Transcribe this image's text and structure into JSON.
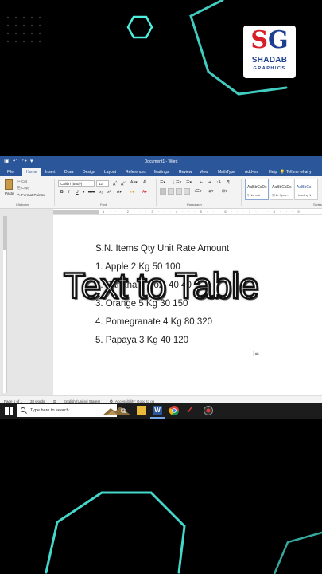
{
  "brand": {
    "logo_initials": "SG",
    "name": "SHADAB",
    "tagline": "GRAPHICS"
  },
  "overlay": {
    "title": "Text to Table"
  },
  "word": {
    "window_title": "Document1 - Word",
    "tabs": [
      "File",
      "Home",
      "Insert",
      "Draw",
      "Design",
      "Layout",
      "References",
      "Mailings",
      "Review",
      "View",
      "MathType",
      "Add-ins",
      "Help"
    ],
    "active_tab": "Home",
    "tell_me": "Tell me what y",
    "ribbon": {
      "clipboard": {
        "paste_label": "Paste",
        "cut_label": "Cut",
        "copy_label": "Copy",
        "format_painter_label": "Format Painter",
        "group_label": "Clipboard"
      },
      "font": {
        "font_name": "Calibri (Body)",
        "font_size": "12",
        "group_label": "Font"
      },
      "paragraph": {
        "group_label": "Paragraph"
      },
      "styles": {
        "items": [
          {
            "sample": "AaBbCcDc",
            "name": "¶ Normal"
          },
          {
            "sample": "AaBbCcDc",
            "name": "¶ No Spac..."
          },
          {
            "sample": "AaBbCc",
            "name": "Heading 1"
          }
        ],
        "group_label": "Styles"
      }
    },
    "ruler_numbers": "1 · · · 2 · · · 3 · · · 4 · · · 5 · · · 6 · · · 7 · · · 8 · · · 9",
    "document_lines": [
      "S.N. Items Qty Unit Rate Amount",
      "1. Apple 2 Kg 50 100",
      "2. Banana 1 Doz. 40 40",
      "3. Orange 5 Kg 30 150",
      "4. Pomegranate 4 Kg 80 320",
      "5. Papaya 3 Kg 40 120"
    ],
    "status": {
      "page": "Page 1 of 1",
      "words": "38 words",
      "language": "English (United States)",
      "accessibility": "Accessibility: Good to go"
    }
  },
  "taskbar": {
    "search_placeholder": "Type here to search"
  },
  "colors": {
    "word_blue": "#2b579a",
    "neon": "#4df0e0",
    "logo_red": "#d61f26",
    "logo_blue": "#1d3f8f"
  }
}
